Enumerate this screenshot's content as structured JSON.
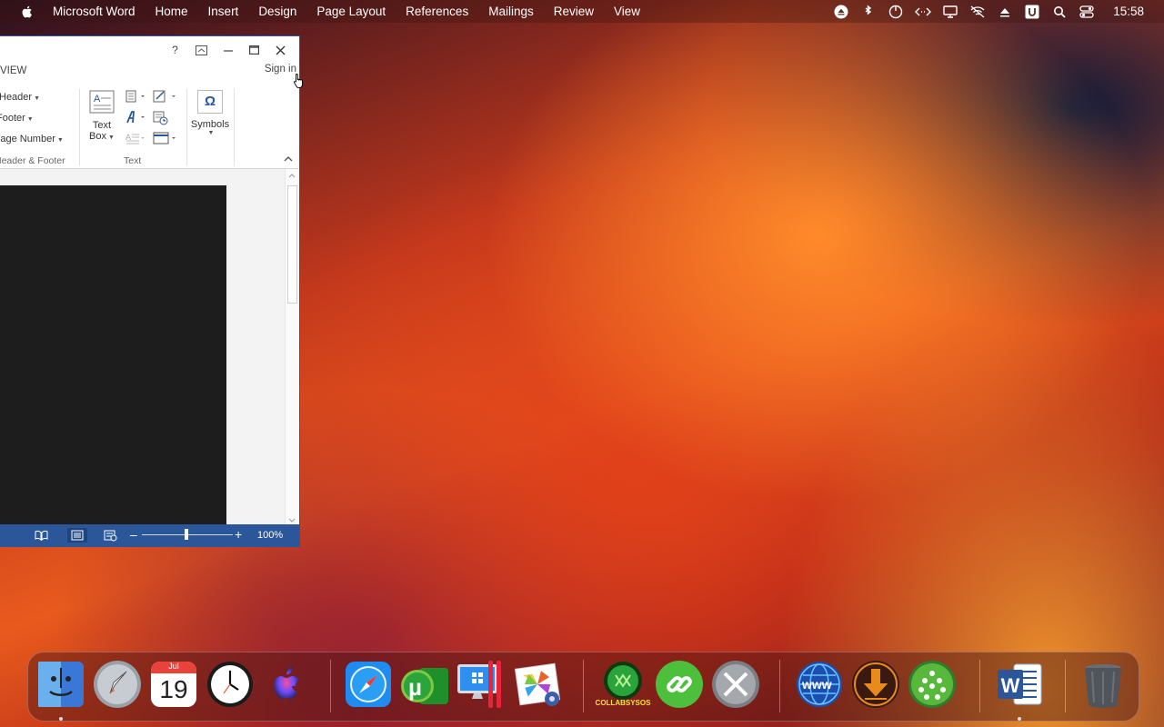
{
  "menubar": {
    "app_name": "Microsoft Word",
    "menus": [
      "Home",
      "Insert",
      "Design",
      "Page Layout",
      "References",
      "Mailings",
      "Review",
      "View"
    ],
    "clock": "15:58"
  },
  "window": {
    "help": "?",
    "tab_partial": "VIEW",
    "sign_in": "Sign in",
    "header_footer": {
      "header": "Header",
      "footer": "Footer",
      "page_number": "Page Number",
      "group_label": "Header & Footer"
    },
    "text_group": {
      "textbox_line1": "Text",
      "textbox_line2": "Box",
      "group_label": "Text"
    },
    "symbols": {
      "label": "Symbols",
      "glyph": "Ω"
    },
    "status": {
      "zoom_level": "100%",
      "zoom_fraction": 0.5
    }
  },
  "dock": {
    "calendar_month": "Jul",
    "calendar_day": "19",
    "collabsysos_label": "COLLABSYSOS",
    "word_letter": "W"
  },
  "colors": {
    "word_blue": "#2b579a",
    "dock_green": "#1f8f2a",
    "download_orange": "#e98a1d"
  }
}
